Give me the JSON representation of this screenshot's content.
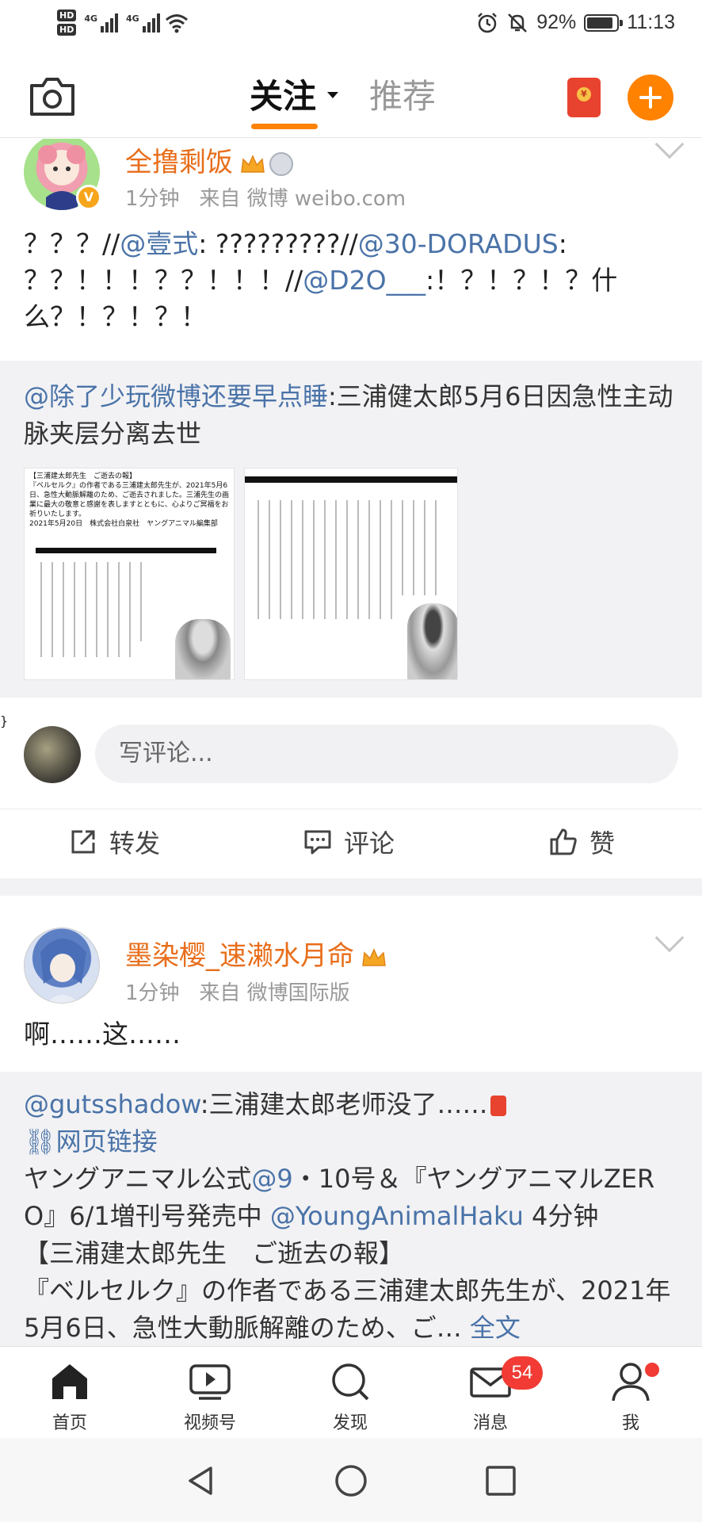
{
  "status_bar": {
    "hd1": "HD",
    "hd2": "HD",
    "network1": "4G",
    "network2": "4G",
    "battery_percent": "92%",
    "battery_level": 0.92,
    "time": "11:13"
  },
  "header": {
    "tab_follow": "关注",
    "tab_recommend": "推荐",
    "accent_color": "#ff8200"
  },
  "post1": {
    "username": "全撸剩饭",
    "time": "1分钟",
    "source": "来自 微博 weibo.com",
    "text_segments": [
      "？？？//",
      "@壹式",
      ": ?????????//",
      "@30-DORADUS",
      ":",
      "？？！！！？？！！！//",
      "@D2O___",
      ":！？！？！？什么？！？！？！"
    ],
    "quote": {
      "author": "@除了少玩微博还要早点睡",
      "text": ":三浦健太郎5月6日因急性主动脉夹层分离去世"
    },
    "image1_text": [
      "【三浦建太郎先生　ご逝去の報】",
      "『ベルセルク』の作者である三浦建太郎先生が、2021年5月6日、急性大動脈解離のため、ご逝去されました。三浦先生の画業に最大の敬意と感謝を表しますとともに、心よりご冥福をお祈りいたします。",
      "2021年5月20日　株式会社白泉社　ヤングアニマル編集部"
    ],
    "comment_placeholder": "写评论...",
    "repost_label": "转发",
    "comment_label": "评论",
    "like_label": "赞"
  },
  "post2": {
    "username": "墨染樱_速濑水月命",
    "time": "1分钟",
    "source": "来自 微博国际版",
    "text": "啊……这……",
    "quote": {
      "author": "@gutsshadow",
      "text1": ":三浦建太郎老师没了……",
      "weblink": "网页链接",
      "line3_a": "ヤングアニマル公式",
      "line3_link": "@9",
      "line3_b": "・10号＆『ヤングアニマルZERO』6/1増刊号発売中 ",
      "line3_link2": "@YoungAnimalHaku",
      "line3_c": " 4分钟",
      "line4": "【三浦建太郎先生　ご逝去の報】",
      "line5": "『ベルセルク』の作者である三浦建太郎先生が、2021年5月6日、急性大動脈解離のため、ご…",
      "full_text": "全文"
    }
  },
  "bottom_nav": {
    "home": "首页",
    "video": "视频号",
    "discover": "发现",
    "messages": "消息",
    "messages_badge": "54",
    "me": "我"
  }
}
